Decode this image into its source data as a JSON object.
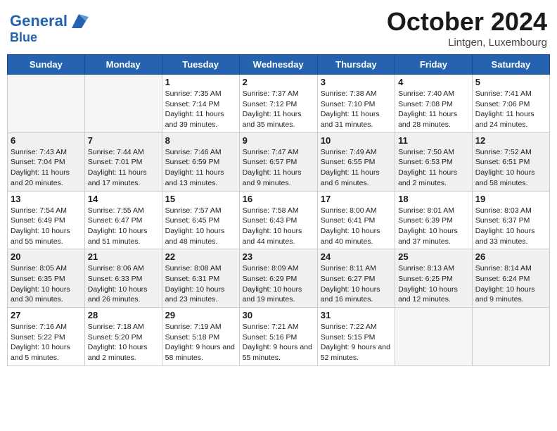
{
  "header": {
    "logo_line1": "General",
    "logo_line2": "Blue",
    "month": "October 2024",
    "location": "Lintgen, Luxembourg"
  },
  "days_of_week": [
    "Sunday",
    "Monday",
    "Tuesday",
    "Wednesday",
    "Thursday",
    "Friday",
    "Saturday"
  ],
  "weeks": [
    [
      {
        "day": "",
        "info": ""
      },
      {
        "day": "",
        "info": ""
      },
      {
        "day": "1",
        "info": "Sunrise: 7:35 AM\nSunset: 7:14 PM\nDaylight: 11 hours and 39 minutes."
      },
      {
        "day": "2",
        "info": "Sunrise: 7:37 AM\nSunset: 7:12 PM\nDaylight: 11 hours and 35 minutes."
      },
      {
        "day": "3",
        "info": "Sunrise: 7:38 AM\nSunset: 7:10 PM\nDaylight: 11 hours and 31 minutes."
      },
      {
        "day": "4",
        "info": "Sunrise: 7:40 AM\nSunset: 7:08 PM\nDaylight: 11 hours and 28 minutes."
      },
      {
        "day": "5",
        "info": "Sunrise: 7:41 AM\nSunset: 7:06 PM\nDaylight: 11 hours and 24 minutes."
      }
    ],
    [
      {
        "day": "6",
        "info": "Sunrise: 7:43 AM\nSunset: 7:04 PM\nDaylight: 11 hours and 20 minutes."
      },
      {
        "day": "7",
        "info": "Sunrise: 7:44 AM\nSunset: 7:01 PM\nDaylight: 11 hours and 17 minutes."
      },
      {
        "day": "8",
        "info": "Sunrise: 7:46 AM\nSunset: 6:59 PM\nDaylight: 11 hours and 13 minutes."
      },
      {
        "day": "9",
        "info": "Sunrise: 7:47 AM\nSunset: 6:57 PM\nDaylight: 11 hours and 9 minutes."
      },
      {
        "day": "10",
        "info": "Sunrise: 7:49 AM\nSunset: 6:55 PM\nDaylight: 11 hours and 6 minutes."
      },
      {
        "day": "11",
        "info": "Sunrise: 7:50 AM\nSunset: 6:53 PM\nDaylight: 11 hours and 2 minutes."
      },
      {
        "day": "12",
        "info": "Sunrise: 7:52 AM\nSunset: 6:51 PM\nDaylight: 10 hours and 58 minutes."
      }
    ],
    [
      {
        "day": "13",
        "info": "Sunrise: 7:54 AM\nSunset: 6:49 PM\nDaylight: 10 hours and 55 minutes."
      },
      {
        "day": "14",
        "info": "Sunrise: 7:55 AM\nSunset: 6:47 PM\nDaylight: 10 hours and 51 minutes."
      },
      {
        "day": "15",
        "info": "Sunrise: 7:57 AM\nSunset: 6:45 PM\nDaylight: 10 hours and 48 minutes."
      },
      {
        "day": "16",
        "info": "Sunrise: 7:58 AM\nSunset: 6:43 PM\nDaylight: 10 hours and 44 minutes."
      },
      {
        "day": "17",
        "info": "Sunrise: 8:00 AM\nSunset: 6:41 PM\nDaylight: 10 hours and 40 minutes."
      },
      {
        "day": "18",
        "info": "Sunrise: 8:01 AM\nSunset: 6:39 PM\nDaylight: 10 hours and 37 minutes."
      },
      {
        "day": "19",
        "info": "Sunrise: 8:03 AM\nSunset: 6:37 PM\nDaylight: 10 hours and 33 minutes."
      }
    ],
    [
      {
        "day": "20",
        "info": "Sunrise: 8:05 AM\nSunset: 6:35 PM\nDaylight: 10 hours and 30 minutes."
      },
      {
        "day": "21",
        "info": "Sunrise: 8:06 AM\nSunset: 6:33 PM\nDaylight: 10 hours and 26 minutes."
      },
      {
        "day": "22",
        "info": "Sunrise: 8:08 AM\nSunset: 6:31 PM\nDaylight: 10 hours and 23 minutes."
      },
      {
        "day": "23",
        "info": "Sunrise: 8:09 AM\nSunset: 6:29 PM\nDaylight: 10 hours and 19 minutes."
      },
      {
        "day": "24",
        "info": "Sunrise: 8:11 AM\nSunset: 6:27 PM\nDaylight: 10 hours and 16 minutes."
      },
      {
        "day": "25",
        "info": "Sunrise: 8:13 AM\nSunset: 6:25 PM\nDaylight: 10 hours and 12 minutes."
      },
      {
        "day": "26",
        "info": "Sunrise: 8:14 AM\nSunset: 6:24 PM\nDaylight: 10 hours and 9 minutes."
      }
    ],
    [
      {
        "day": "27",
        "info": "Sunrise: 7:16 AM\nSunset: 5:22 PM\nDaylight: 10 hours and 5 minutes."
      },
      {
        "day": "28",
        "info": "Sunrise: 7:18 AM\nSunset: 5:20 PM\nDaylight: 10 hours and 2 minutes."
      },
      {
        "day": "29",
        "info": "Sunrise: 7:19 AM\nSunset: 5:18 PM\nDaylight: 9 hours and 58 minutes."
      },
      {
        "day": "30",
        "info": "Sunrise: 7:21 AM\nSunset: 5:16 PM\nDaylight: 9 hours and 55 minutes."
      },
      {
        "day": "31",
        "info": "Sunrise: 7:22 AM\nSunset: 5:15 PM\nDaylight: 9 hours and 52 minutes."
      },
      {
        "day": "",
        "info": ""
      },
      {
        "day": "",
        "info": ""
      }
    ]
  ]
}
